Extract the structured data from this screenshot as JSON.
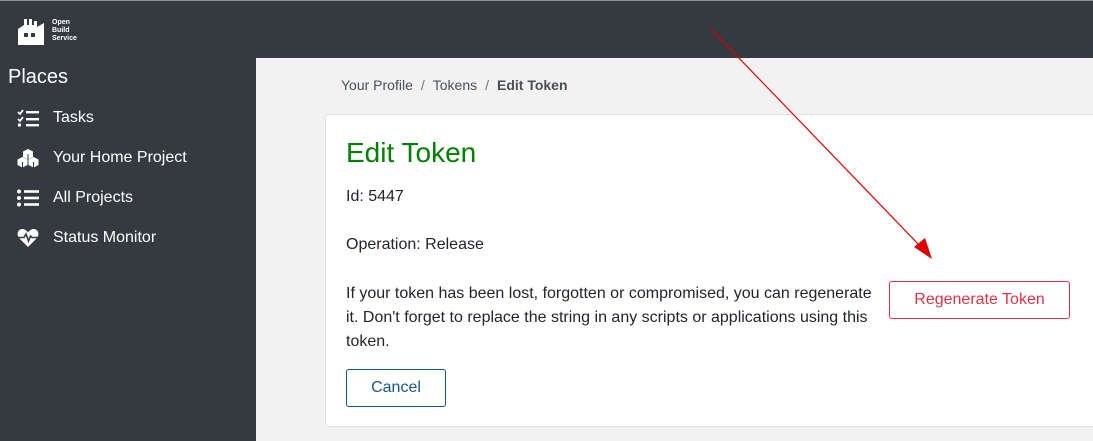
{
  "brand": {
    "line1": "Open",
    "line2": "Build",
    "line3": "Service",
    "icon": "factory-logo-icon"
  },
  "sidebar": {
    "heading": "Places",
    "items": [
      {
        "label": "Tasks",
        "icon": "tasks-icon"
      },
      {
        "label": "Your Home Project",
        "icon": "cubes-icon"
      },
      {
        "label": "All Projects",
        "icon": "list-icon"
      },
      {
        "label": "Status Monitor",
        "icon": "heartbeat-icon"
      }
    ]
  },
  "breadcrumb": {
    "items": [
      "Your Profile",
      "Tokens"
    ],
    "separator": "/",
    "current": "Edit Token"
  },
  "main": {
    "title": "Edit Token",
    "id_line": "Id: 5447",
    "operation_line": "Operation: Release",
    "description": "If your token has been lost, forgotten or compromised, you can regenerate it. Don't forget to replace the string in any scripts or applications using this token.",
    "regenerate_label": "Regenerate Token",
    "cancel_label": "Cancel"
  },
  "colors": {
    "title": "#008000",
    "danger": "#dc3545",
    "cancel": "#17577f",
    "sidebar": "#343a40",
    "annotation_arrow": "#e00000"
  }
}
